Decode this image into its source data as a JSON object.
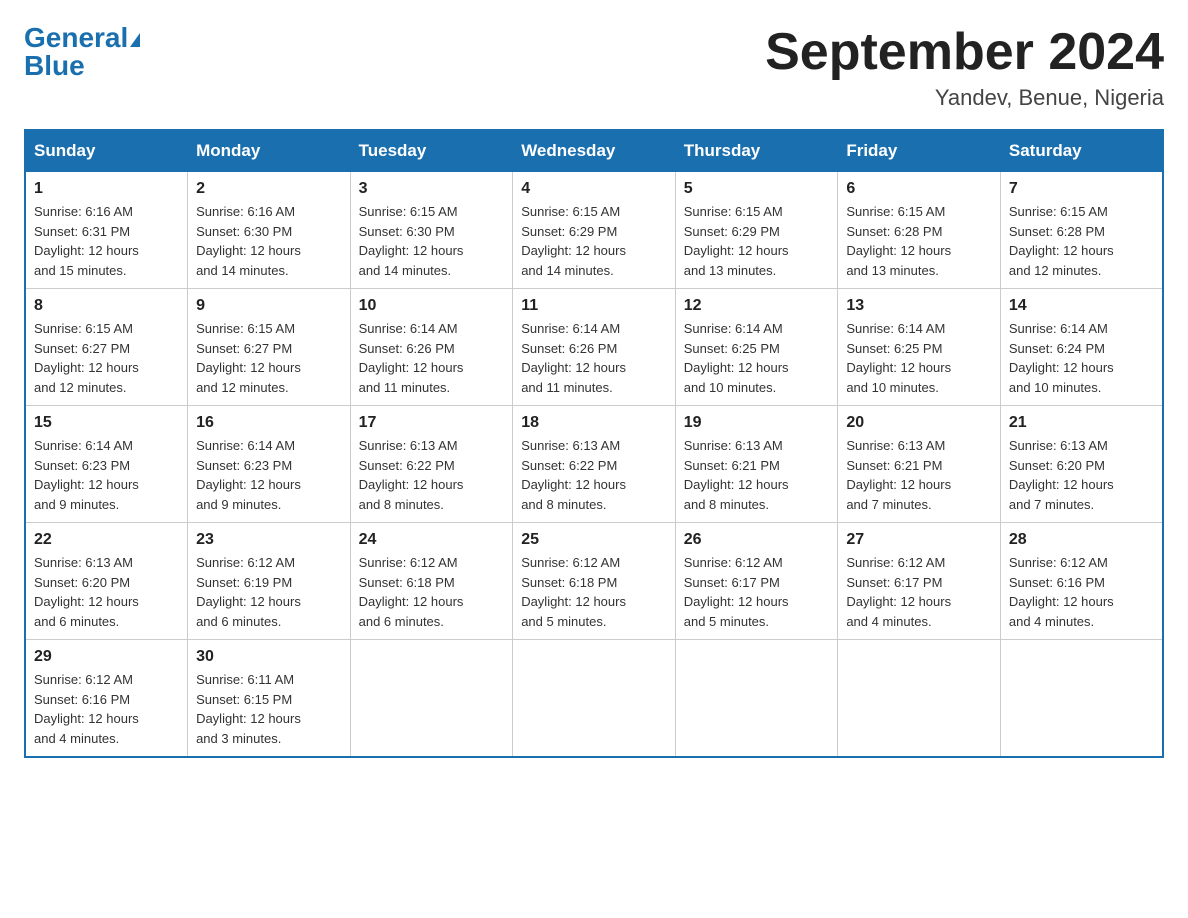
{
  "header": {
    "logo_general": "General",
    "logo_blue": "Blue",
    "title": "September 2024",
    "location": "Yandev, Benue, Nigeria"
  },
  "days_of_week": [
    "Sunday",
    "Monday",
    "Tuesday",
    "Wednesday",
    "Thursday",
    "Friday",
    "Saturday"
  ],
  "weeks": [
    [
      {
        "day": "1",
        "sunrise": "6:16 AM",
        "sunset": "6:31 PM",
        "daylight": "12 hours and 15 minutes."
      },
      {
        "day": "2",
        "sunrise": "6:16 AM",
        "sunset": "6:30 PM",
        "daylight": "12 hours and 14 minutes."
      },
      {
        "day": "3",
        "sunrise": "6:15 AM",
        "sunset": "6:30 PM",
        "daylight": "12 hours and 14 minutes."
      },
      {
        "day": "4",
        "sunrise": "6:15 AM",
        "sunset": "6:29 PM",
        "daylight": "12 hours and 14 minutes."
      },
      {
        "day": "5",
        "sunrise": "6:15 AM",
        "sunset": "6:29 PM",
        "daylight": "12 hours and 13 minutes."
      },
      {
        "day": "6",
        "sunrise": "6:15 AM",
        "sunset": "6:28 PM",
        "daylight": "12 hours and 13 minutes."
      },
      {
        "day": "7",
        "sunrise": "6:15 AM",
        "sunset": "6:28 PM",
        "daylight": "12 hours and 12 minutes."
      }
    ],
    [
      {
        "day": "8",
        "sunrise": "6:15 AM",
        "sunset": "6:27 PM",
        "daylight": "12 hours and 12 minutes."
      },
      {
        "day": "9",
        "sunrise": "6:15 AM",
        "sunset": "6:27 PM",
        "daylight": "12 hours and 12 minutes."
      },
      {
        "day": "10",
        "sunrise": "6:14 AM",
        "sunset": "6:26 PM",
        "daylight": "12 hours and 11 minutes."
      },
      {
        "day": "11",
        "sunrise": "6:14 AM",
        "sunset": "6:26 PM",
        "daylight": "12 hours and 11 minutes."
      },
      {
        "day": "12",
        "sunrise": "6:14 AM",
        "sunset": "6:25 PM",
        "daylight": "12 hours and 10 minutes."
      },
      {
        "day": "13",
        "sunrise": "6:14 AM",
        "sunset": "6:25 PM",
        "daylight": "12 hours and 10 minutes."
      },
      {
        "day": "14",
        "sunrise": "6:14 AM",
        "sunset": "6:24 PM",
        "daylight": "12 hours and 10 minutes."
      }
    ],
    [
      {
        "day": "15",
        "sunrise": "6:14 AM",
        "sunset": "6:23 PM",
        "daylight": "12 hours and 9 minutes."
      },
      {
        "day": "16",
        "sunrise": "6:14 AM",
        "sunset": "6:23 PM",
        "daylight": "12 hours and 9 minutes."
      },
      {
        "day": "17",
        "sunrise": "6:13 AM",
        "sunset": "6:22 PM",
        "daylight": "12 hours and 8 minutes."
      },
      {
        "day": "18",
        "sunrise": "6:13 AM",
        "sunset": "6:22 PM",
        "daylight": "12 hours and 8 minutes."
      },
      {
        "day": "19",
        "sunrise": "6:13 AM",
        "sunset": "6:21 PM",
        "daylight": "12 hours and 8 minutes."
      },
      {
        "day": "20",
        "sunrise": "6:13 AM",
        "sunset": "6:21 PM",
        "daylight": "12 hours and 7 minutes."
      },
      {
        "day": "21",
        "sunrise": "6:13 AM",
        "sunset": "6:20 PM",
        "daylight": "12 hours and 7 minutes."
      }
    ],
    [
      {
        "day": "22",
        "sunrise": "6:13 AM",
        "sunset": "6:20 PM",
        "daylight": "12 hours and 6 minutes."
      },
      {
        "day": "23",
        "sunrise": "6:12 AM",
        "sunset": "6:19 PM",
        "daylight": "12 hours and 6 minutes."
      },
      {
        "day": "24",
        "sunrise": "6:12 AM",
        "sunset": "6:18 PM",
        "daylight": "12 hours and 6 minutes."
      },
      {
        "day": "25",
        "sunrise": "6:12 AM",
        "sunset": "6:18 PM",
        "daylight": "12 hours and 5 minutes."
      },
      {
        "day": "26",
        "sunrise": "6:12 AM",
        "sunset": "6:17 PM",
        "daylight": "12 hours and 5 minutes."
      },
      {
        "day": "27",
        "sunrise": "6:12 AM",
        "sunset": "6:17 PM",
        "daylight": "12 hours and 4 minutes."
      },
      {
        "day": "28",
        "sunrise": "6:12 AM",
        "sunset": "6:16 PM",
        "daylight": "12 hours and 4 minutes."
      }
    ],
    [
      {
        "day": "29",
        "sunrise": "6:12 AM",
        "sunset": "6:16 PM",
        "daylight": "12 hours and 4 minutes."
      },
      {
        "day": "30",
        "sunrise": "6:11 AM",
        "sunset": "6:15 PM",
        "daylight": "12 hours and 3 minutes."
      },
      null,
      null,
      null,
      null,
      null
    ]
  ],
  "labels": {
    "sunrise": "Sunrise:",
    "sunset": "Sunset:",
    "daylight": "Daylight:"
  }
}
